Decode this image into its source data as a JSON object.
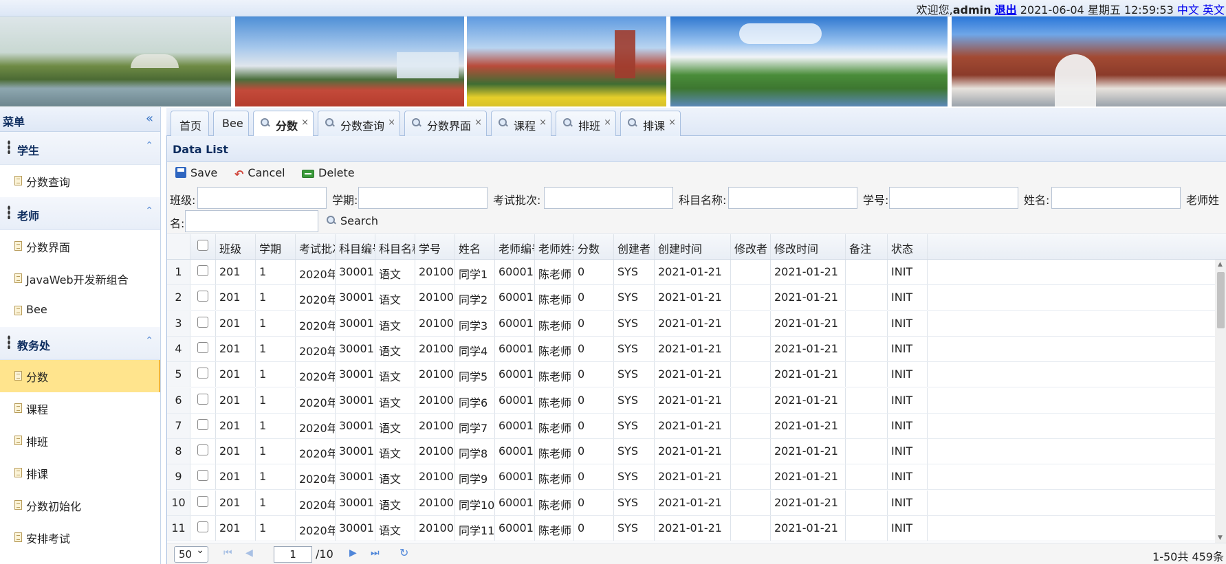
{
  "topbar": {
    "welcome": "欢迎您,",
    "user": "admin",
    "logout": "退出",
    "datetime": "2021-06-04 星期五 12:59:53",
    "lang_zh": "中文",
    "lang_en": "英文"
  },
  "sidebar": {
    "title": "菜单",
    "collapse_icon": "«",
    "groups": [
      {
        "label": "学生",
        "items": [
          "分数查询"
        ]
      },
      {
        "label": "老师",
        "items": [
          "分数界面",
          "JavaWeb开发新组合",
          "Bee"
        ]
      },
      {
        "label": "教务处",
        "items": [
          "分数",
          "课程",
          "排班",
          "排课",
          "分数初始化",
          "安排考试"
        ]
      }
    ],
    "active_item": "分数"
  },
  "tabs": [
    {
      "label": "首页",
      "icon": false,
      "closable": false
    },
    {
      "label": "Bee",
      "icon": false,
      "closable": false
    },
    {
      "label": "分数",
      "icon": true,
      "closable": true,
      "active": true
    },
    {
      "label": "分数查询",
      "icon": true,
      "closable": true
    },
    {
      "label": "分数界面",
      "icon": true,
      "closable": true
    },
    {
      "label": "课程",
      "icon": true,
      "closable": true
    },
    {
      "label": "排班",
      "icon": true,
      "closable": true
    },
    {
      "label": "排课",
      "icon": true,
      "closable": true
    }
  ],
  "panel": {
    "title": "Data List",
    "toolbar": {
      "save": "Save",
      "cancel": "Cancel",
      "delete": "Delete"
    },
    "filters": {
      "class": "班级:",
      "term": "学期:",
      "exam_batch": "考试批次:",
      "subject_name": "科目名称:",
      "student_no": "学号:",
      "name": "姓名:",
      "teacher_name_a": "老师姓",
      "teacher_name_b": "名:",
      "search": "Search"
    }
  },
  "grid": {
    "columns": [
      "班级",
      "学期",
      "考试批次",
      "科目编号",
      "科目名称",
      "学号",
      "姓名",
      "老师编号",
      "老师姓名",
      "分数",
      "创建者",
      "创建时间",
      "修改者",
      "修改时间",
      "备注",
      "状态"
    ],
    "rows": [
      [
        "1",
        "201",
        "1",
        "2020年",
        "30001",
        "语文",
        "20100",
        "同学1",
        "60001",
        "陈老师",
        "0",
        "SYS",
        "2021-01-21",
        "",
        "2021-01-21",
        "",
        "INIT"
      ],
      [
        "2",
        "201",
        "1",
        "2020年",
        "30001",
        "语文",
        "20100",
        "同学2",
        "60001",
        "陈老师",
        "0",
        "SYS",
        "2021-01-21",
        "",
        "2021-01-21",
        "",
        "INIT"
      ],
      [
        "3",
        "201",
        "1",
        "2020年",
        "30001",
        "语文",
        "20100",
        "同学3",
        "60001",
        "陈老师",
        "0",
        "SYS",
        "2021-01-21",
        "",
        "2021-01-21",
        "",
        "INIT"
      ],
      [
        "4",
        "201",
        "1",
        "2020年",
        "30001",
        "语文",
        "20100",
        "同学4",
        "60001",
        "陈老师",
        "0",
        "SYS",
        "2021-01-21",
        "",
        "2021-01-21",
        "",
        "INIT"
      ],
      [
        "5",
        "201",
        "1",
        "2020年",
        "30001",
        "语文",
        "20100",
        "同学5",
        "60001",
        "陈老师",
        "0",
        "SYS",
        "2021-01-21",
        "",
        "2021-01-21",
        "",
        "INIT"
      ],
      [
        "6",
        "201",
        "1",
        "2020年",
        "30001",
        "语文",
        "20100",
        "同学6",
        "60001",
        "陈老师",
        "0",
        "SYS",
        "2021-01-21",
        "",
        "2021-01-21",
        "",
        "INIT"
      ],
      [
        "7",
        "201",
        "1",
        "2020年",
        "30001",
        "语文",
        "20100",
        "同学7",
        "60001",
        "陈老师",
        "0",
        "SYS",
        "2021-01-21",
        "",
        "2021-01-21",
        "",
        "INIT"
      ],
      [
        "8",
        "201",
        "1",
        "2020年",
        "30001",
        "语文",
        "20100",
        "同学8",
        "60001",
        "陈老师",
        "0",
        "SYS",
        "2021-01-21",
        "",
        "2021-01-21",
        "",
        "INIT"
      ],
      [
        "9",
        "201",
        "1",
        "2020年",
        "30001",
        "语文",
        "20100",
        "同学9",
        "60001",
        "陈老师",
        "0",
        "SYS",
        "2021-01-21",
        "",
        "2021-01-21",
        "",
        "INIT"
      ],
      [
        "10",
        "201",
        "1",
        "2020年",
        "30001",
        "语文",
        "20100",
        "同学10",
        "60001",
        "陈老师",
        "0",
        "SYS",
        "2021-01-21",
        "",
        "2021-01-21",
        "",
        "INIT"
      ],
      [
        "11",
        "201",
        "1",
        "2020年",
        "30001",
        "语文",
        "20100",
        "同学11",
        "60001",
        "陈老师",
        "0",
        "SYS",
        "2021-01-21",
        "",
        "2021-01-21",
        "",
        "INIT"
      ]
    ]
  },
  "pager": {
    "page_size": "50",
    "page": "1",
    "total_pages": "/10",
    "info": "1-50共 459条"
  }
}
